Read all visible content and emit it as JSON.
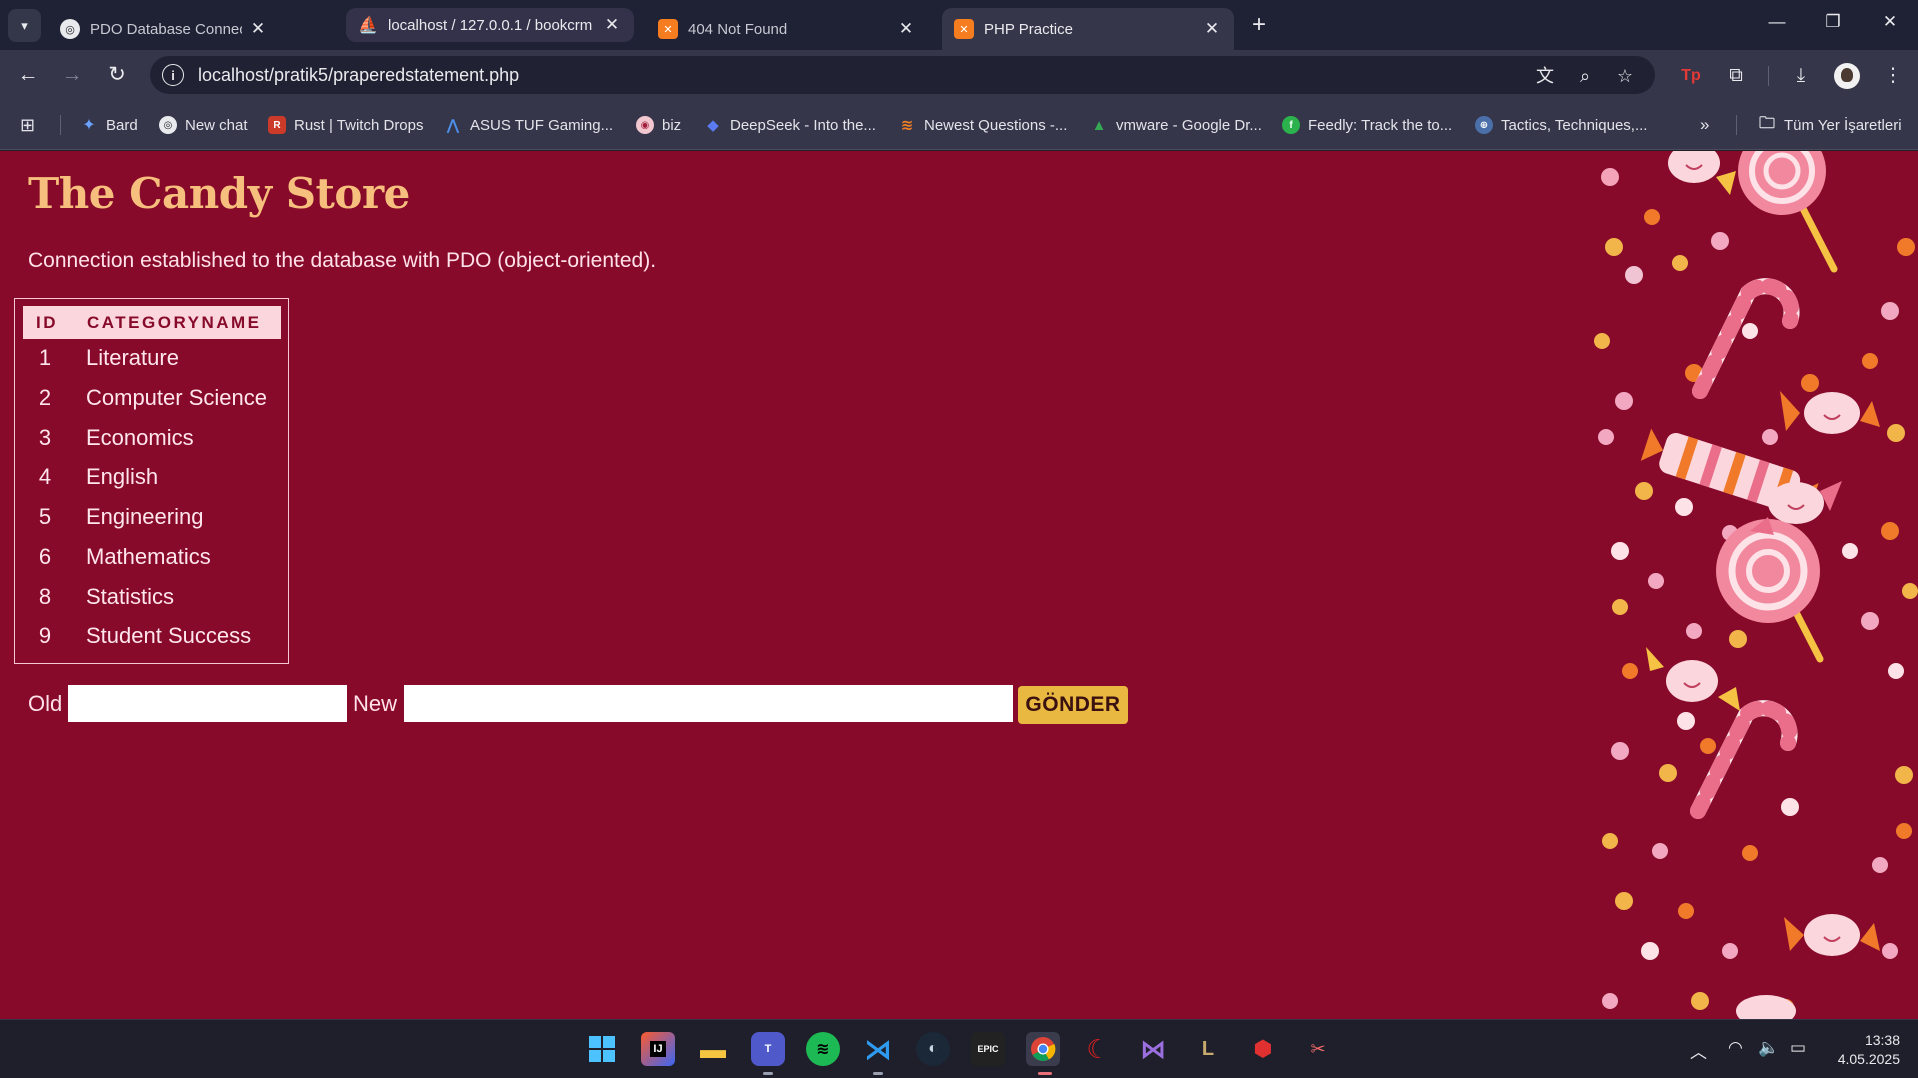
{
  "browser": {
    "tabs": [
      {
        "title": "PDO Database Connection Setu",
        "state": "inactive"
      },
      {
        "title": "localhost / 127.0.0.1 / bookcrm",
        "state": "hover"
      },
      {
        "title": "404 Not Found",
        "state": "inactive"
      },
      {
        "title": "PHP Practice",
        "state": "active"
      }
    ],
    "url": "localhost/pratik5/praperedstatement.php",
    "bookmarks": [
      {
        "label": "Bard",
        "icon": "bard-icon"
      },
      {
        "label": "New chat",
        "icon": "openai-icon"
      },
      {
        "label": "Rust | Twitch Drops",
        "icon": "rust-icon"
      },
      {
        "label": "ASUS TUF Gaming...",
        "icon": "asus-tuf-icon"
      },
      {
        "label": "biz",
        "icon": "biz-icon"
      },
      {
        "label": "DeepSeek - Into the...",
        "icon": "deepseek-icon"
      },
      {
        "label": "Newest Questions -...",
        "icon": "stackoverflow-icon"
      },
      {
        "label": "vmware - Google Dr...",
        "icon": "google-drive-icon"
      },
      {
        "label": "Feedly: Track the to...",
        "icon": "feedly-icon"
      },
      {
        "label": "Tactics, Techniques,...",
        "icon": "mitre-icon"
      }
    ],
    "all_bookmarks_label": "Tüm Yer İşaretleri"
  },
  "page": {
    "title": "The Candy Store",
    "connection_message": "Connection established to the database with PDO (object-oriented).",
    "table": {
      "headers": [
        "ID",
        "CATEGORYNAME"
      ],
      "rows": [
        {
          "id": "1",
          "name": "Literature"
        },
        {
          "id": "2",
          "name": "Computer Science"
        },
        {
          "id": "3",
          "name": "Economics"
        },
        {
          "id": "4",
          "name": "English"
        },
        {
          "id": "5",
          "name": "Engineering"
        },
        {
          "id": "6",
          "name": "Mathematics"
        },
        {
          "id": "8",
          "name": "Statistics"
        },
        {
          "id": "9",
          "name": "Student Success"
        }
      ]
    },
    "form": {
      "old_label": "Old",
      "old_value": "",
      "new_label": "New",
      "new_value": "",
      "submit_label": "GÖNDER"
    },
    "colors": {
      "background": "#880a2a",
      "title": "#f7bf7d",
      "header_bg": "#fbd7dd",
      "button": "#e8b840"
    }
  },
  "taskbar": {
    "apps": [
      "windows-start",
      "intellij",
      "file-explorer",
      "teams",
      "spotify",
      "vscode",
      "steam",
      "epic-games",
      "chrome",
      "app-red-swirl",
      "visual-studio",
      "league-of-legends",
      "riot-vanguard",
      "snipping-tool"
    ],
    "time": "13:38",
    "date": "4.05.2025"
  }
}
